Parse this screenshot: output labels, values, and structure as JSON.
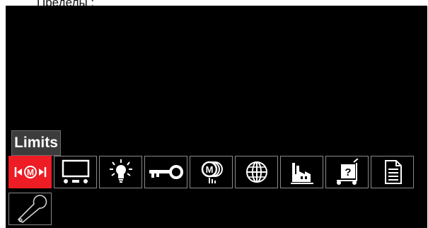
{
  "caption": "Пределы :",
  "tooltip": {
    "label": "Limits"
  },
  "menu": {
    "items": [
      {
        "icon": "limits-m-icon",
        "selected": true
      },
      {
        "icon": "display-icon"
      },
      {
        "icon": "lightbulb-icon"
      },
      {
        "icon": "key-icon"
      },
      {
        "icon": "weld-modes-icon"
      },
      {
        "icon": "globe-icon"
      },
      {
        "icon": "factory-icon"
      },
      {
        "icon": "cart-help-icon"
      },
      {
        "icon": "document-icon"
      },
      {
        "icon": "wrench-icon"
      }
    ]
  },
  "colors": {
    "screen_bg": "#000000",
    "selected_bg": "#ee1c24",
    "tooltip_bg": "#3c3c3c",
    "icon": "#ffffff",
    "tile_border": "#8a8a8a"
  }
}
